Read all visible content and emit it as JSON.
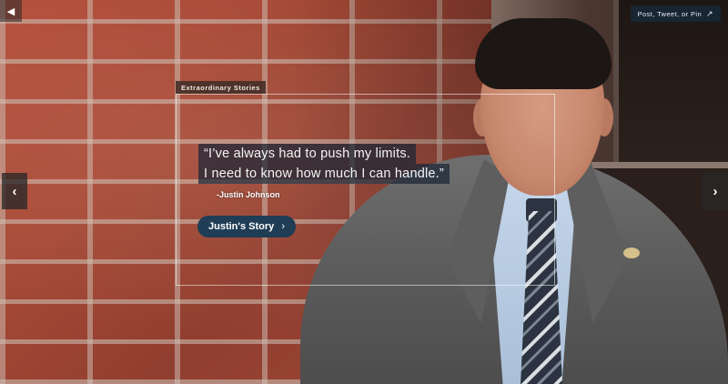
{
  "header": {
    "back_icon": "chevron-left-icon",
    "share_label": "Post, Tweet, or Pin",
    "share_icon": "share-arrow-icon"
  },
  "story": {
    "tag": "Extraordinary Stories",
    "quote_line1": "“I’ve always had to push my limits.",
    "quote_line2": "I need to know how much I can handle.”",
    "attribution": "-Justin Johnson",
    "button_label": "Justin's Story",
    "button_icon": "chevron-right-icon"
  },
  "carousel": {
    "prev_icon": "chevron-left-icon",
    "next_icon": "chevron-right-icon"
  },
  "colors": {
    "button_bg": "#1f3d55",
    "quote_bg": "#1a2636",
    "tag_bg": "#46302a"
  }
}
